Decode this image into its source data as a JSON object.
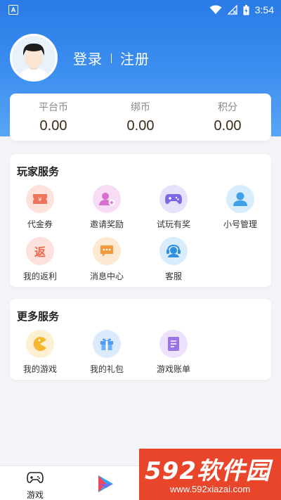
{
  "status_bar": {
    "time": "3:54",
    "app_badge": "A"
  },
  "profile": {
    "login_label": "登录",
    "register_label": "注册"
  },
  "balances": [
    {
      "label": "平台币",
      "value": "0.00"
    },
    {
      "label": "绑币",
      "value": "0.00"
    },
    {
      "label": "积分",
      "value": "0.00"
    }
  ],
  "player_services": {
    "title": "玩家服务",
    "items": [
      {
        "label": "代金券",
        "icon": "voucher-icon"
      },
      {
        "label": "邀请奖励",
        "icon": "invite-reward-icon"
      },
      {
        "label": "试玩有奖",
        "icon": "gamepad-icon"
      },
      {
        "label": "小号管理",
        "icon": "user-icon"
      },
      {
        "label": "我的返利",
        "icon": "rebate-icon",
        "glyph": "返"
      },
      {
        "label": "消息中心",
        "icon": "message-icon"
      },
      {
        "label": "客服",
        "icon": "headset-icon"
      }
    ]
  },
  "more_services": {
    "title": "更多服务",
    "items": [
      {
        "label": "我的游戏",
        "icon": "pacman-icon"
      },
      {
        "label": "我的礼包",
        "icon": "gift-icon"
      },
      {
        "label": "游戏账单",
        "icon": "bill-icon"
      }
    ]
  },
  "bottom_nav": {
    "games_label": "游戏"
  },
  "watermark": {
    "brand": "592软件园",
    "url": "www.592xiazai.com"
  },
  "colors": {
    "primary": "#2a7be6",
    "watermark": "#e8452a"
  }
}
